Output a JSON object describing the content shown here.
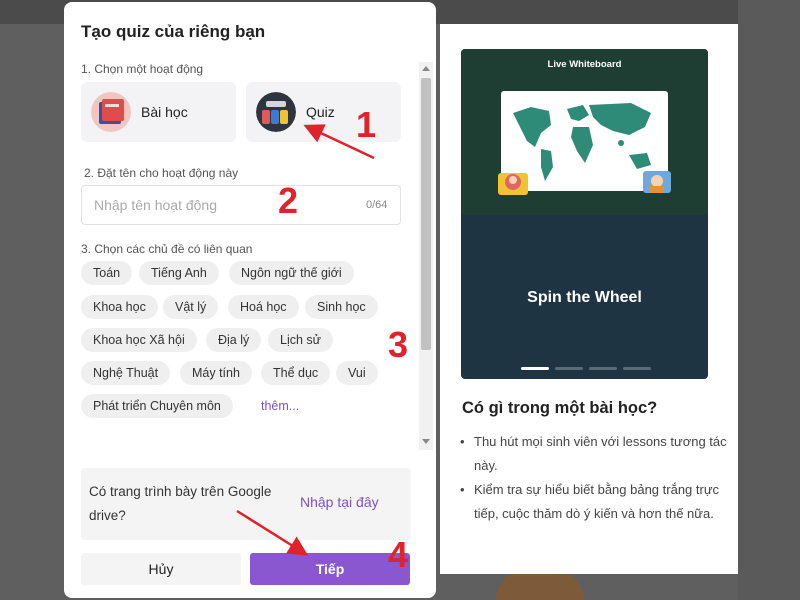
{
  "modal": {
    "title": "Tạo quiz của riêng bạn",
    "step1_label": "1. Chọn một hoạt động",
    "activities": [
      {
        "label": "Bài học",
        "icon": "lesson-icon"
      },
      {
        "label": "Quiz",
        "icon": "quiz-icon"
      }
    ],
    "step2_label": "2. Đặt tên cho hoạt động này",
    "name_input": {
      "placeholder": "Nhập tên hoạt động",
      "value": "",
      "char_count": "0/64"
    },
    "step3_label": "3. Chọn các chủ đề có liên quan",
    "topics": [
      "Toán",
      "Tiếng Anh",
      "Ngôn ngữ thế giới",
      "Khoa học",
      "Vật lý",
      "Hoá học",
      "Sinh học",
      "Khoa học Xã hội",
      "Địa lý",
      "Lịch sử",
      "Nghệ Thuật",
      "Máy tính",
      "Thể dục",
      "Vui",
      "Phát triển Chuyên môn"
    ],
    "more_link": "thêm...",
    "drive_prompt": "Có trang trình bày trên Google drive?",
    "drive_link": "Nhập tại đây",
    "cancel_button": "Hủy",
    "next_button": "Tiếp"
  },
  "panel": {
    "preview_header": "Live Whiteboard",
    "preview_title": "Spin the Wheel",
    "carousel": {
      "count": 4,
      "active": 1
    },
    "heading": "Có gì trong một bài học?",
    "bullets": [
      "Thu hút mọi sinh viên với lessons tương tác này.",
      "Kiểm tra sự hiểu biết bằng bảng trắng trực tiếp, cuộc thăm dò ý kiến và hơn thế nữa."
    ]
  },
  "annotations": [
    "1",
    "2",
    "3",
    "4"
  ],
  "colors": {
    "accent": "#8a57d0",
    "annotation": "#e0222a",
    "preview_bg": "#1f3443",
    "whiteboard_bg": "#1e3d33"
  }
}
